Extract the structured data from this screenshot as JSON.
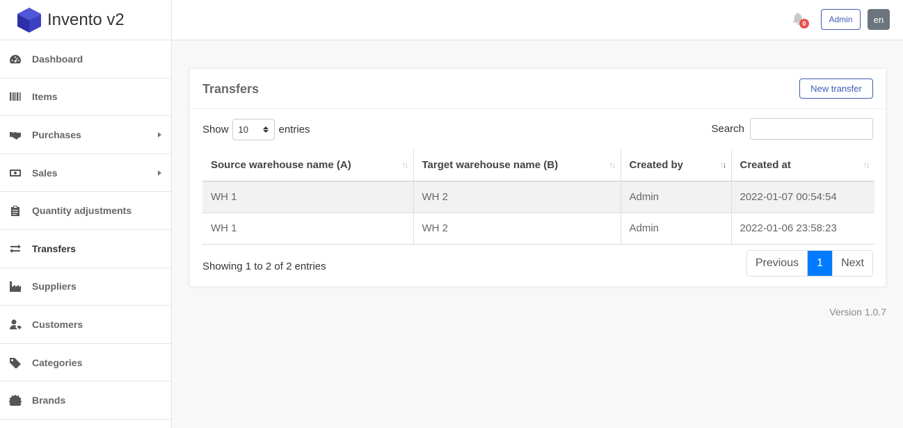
{
  "app": {
    "title": "Invento v2"
  },
  "sidebar": {
    "items": [
      {
        "label": "Dashboard",
        "icon": "tachometer-icon"
      },
      {
        "label": "Items",
        "icon": "barcode-icon"
      },
      {
        "label": "Purchases",
        "icon": "handshake-icon",
        "has_submenu": true
      },
      {
        "label": "Sales",
        "icon": "money-bill-icon",
        "has_submenu": true
      },
      {
        "label": "Quantity adjustments",
        "icon": "clipboard-icon"
      },
      {
        "label": "Transfers",
        "icon": "exchange-icon",
        "active": true
      },
      {
        "label": "Suppliers",
        "icon": "industry-icon"
      },
      {
        "label": "Customers",
        "icon": "user-tag-icon"
      },
      {
        "label": "Categories",
        "icon": "tag-icon"
      },
      {
        "label": "Brands",
        "icon": "certificate-icon"
      }
    ]
  },
  "topbar": {
    "notification_count": "0",
    "user_button": "Admin",
    "language_button": "en"
  },
  "card": {
    "title": "Transfers",
    "new_button": "New transfer",
    "length": {
      "show": "Show",
      "value": "10",
      "entries": "entries"
    },
    "search_label": "Search",
    "search_value": "",
    "columns": [
      "Source warehouse name (A)",
      "Target warehouse name (B)",
      "Created by",
      "Created at"
    ],
    "rows": [
      [
        "WH 1",
        "WH 2",
        "Admin",
        "2022-01-07 00:54:54"
      ],
      [
        "WH 1",
        "WH 2",
        "Admin",
        "2022-01-06 23:58:23"
      ]
    ],
    "info": "Showing 1 to 2 of 2 entries",
    "pagination": {
      "previous": "Previous",
      "current": "1",
      "next": "Next"
    }
  },
  "footer": {
    "version": "Version 1.0.7"
  },
  "colors": {
    "primary": "#3f5bb5",
    "active_page": "#007bff",
    "badge": "#e94f4f"
  }
}
